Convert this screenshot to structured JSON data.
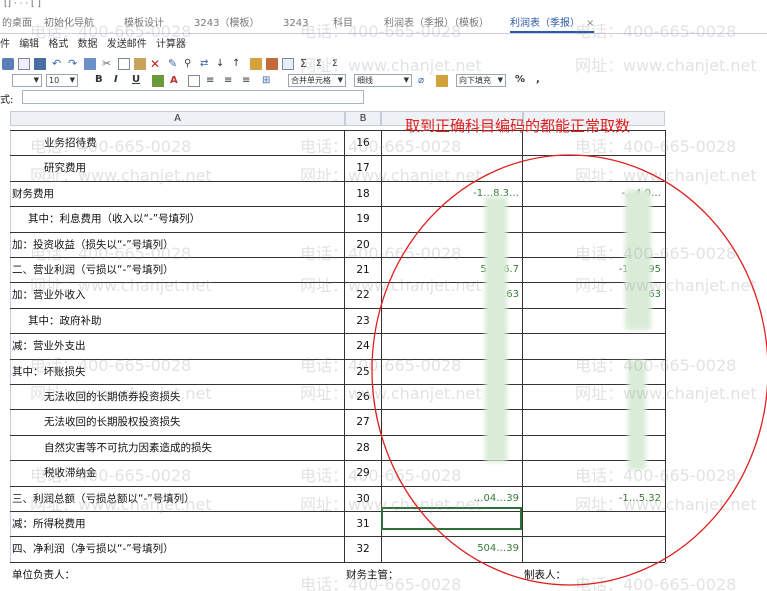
{
  "titlebar": {
    "text": "[]  ·  ·  · [ ]"
  },
  "tabs": [
    {
      "label": "的桌面"
    },
    {
      "label": "初始化导航"
    },
    {
      "label": "模板设计"
    },
    {
      "label": "3243（模板）"
    },
    {
      "label": "3243"
    },
    {
      "label": "科目"
    },
    {
      "label": "利润表（季报）（模板）"
    },
    {
      "label": "利润表（季报）"
    }
  ],
  "active_tab_close": "×",
  "menu": [
    "件",
    "编辑",
    "格式",
    "数据",
    "发送邮件",
    "计算器"
  ],
  "toolbar": {
    "font_size": "10",
    "format_buttons": [
      "B",
      "I",
      "U"
    ],
    "merge": "合并单元格",
    "border": "细线",
    "fill": "向下填充",
    "percent": "%",
    "comma": ","
  },
  "formula_label": "式:",
  "columns": [
    "A",
    "B"
  ],
  "annotation": "取到正确科目编码的都能正常取数",
  "rows": [
    {
      "label": "业务招待费",
      "indent": 2,
      "num": "16",
      "v1": "",
      "v2": ""
    },
    {
      "label": "研究费用",
      "indent": 2,
      "num": "17",
      "v1": "",
      "v2": ""
    },
    {
      "label": "财务费用",
      "indent": 0,
      "num": "18",
      "v1": "-1…8.3…",
      "v2": "-…4.0…"
    },
    {
      "label": "其中：利息费用（收入以“-”号填列）",
      "indent": 1,
      "num": "19",
      "v1": "",
      "v2": ""
    },
    {
      "label": "加：投资收益（损失以“-”号填列）",
      "indent": 0,
      "num": "20",
      "v1": "",
      "v2": ""
    },
    {
      "label": "二、营业利润（亏损以“-”号填列）",
      "indent": 0,
      "num": "21",
      "v1": "5…46.7",
      "v2": "-13…,95"
    },
    {
      "label": "加：营业外收入",
      "indent": 0,
      "num": "22",
      "v1": "…5.63",
      "v2": "…63"
    },
    {
      "label": "其中：政府补助",
      "indent": 1,
      "num": "23",
      "v1": "",
      "v2": ""
    },
    {
      "label": "减：营业外支出",
      "indent": 0,
      "num": "24",
      "v1": "",
      "v2": ""
    },
    {
      "label": "其中：坏账损失",
      "indent": 0,
      "num": "25",
      "v1": "",
      "v2": ""
    },
    {
      "label": "无法收回的长期债券投资损失",
      "indent": 2,
      "num": "26",
      "v1": "",
      "v2": ""
    },
    {
      "label": "无法收回的长期股权投资损失",
      "indent": 2,
      "num": "27",
      "v1": "",
      "v2": ""
    },
    {
      "label": "自然灾害等不可抗力因素造成的损失",
      "indent": 2,
      "num": "28",
      "v1": "",
      "v2": ""
    },
    {
      "label": "税收滞纳金",
      "indent": 2,
      "num": "29",
      "v1": "",
      "v2": ""
    },
    {
      "label": "三、利润总额（亏损总额以“-”号填列）",
      "indent": 0,
      "num": "30",
      "v1": "…04…39",
      "v2": "-1…5.32"
    },
    {
      "label": "减：所得税费用",
      "indent": 0,
      "num": "31",
      "v1": "",
      "v2": ""
    },
    {
      "label": "四、净利润（净亏损以“-”号填列）",
      "indent": 0,
      "num": "32",
      "v1": "504…39",
      "v2": ""
    }
  ],
  "footer": {
    "unit_head": "单位负责人：",
    "finance_head": "财务主管：",
    "preparer": "制表人："
  },
  "watermark": {
    "phone": "电话：400-665-0028",
    "site": "网址：www.chanjet.net"
  },
  "colors": {
    "annotation": "#e02020",
    "tab_active": "#2a5aa8",
    "value_text": "#3a7a3a",
    "selection": "#2f6f3a"
  }
}
